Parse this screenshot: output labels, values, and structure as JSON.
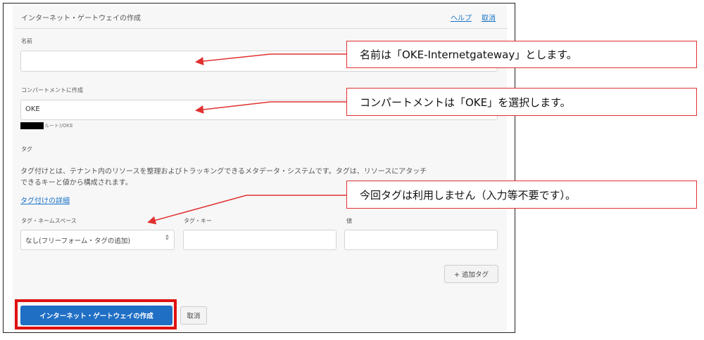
{
  "header": {
    "title": "インターネット・ゲートウェイの作成",
    "help_link": "ヘルプ",
    "cancel_link": "取消"
  },
  "name_field": {
    "label": "名前",
    "value": ""
  },
  "compartment_field": {
    "label": "コンパートメントに作成",
    "value": "OKE",
    "path": "ルート)/OKE"
  },
  "tags": {
    "heading": "タグ",
    "description_line1": "タグ付けとは、テナント内のリソースを整理およびトラッキングできるメタデータ・システムです。タグは、リソースにアタッチ",
    "description_line2": "できるキーと値から構成されます。",
    "learn_more_link": "タグ付けの詳細",
    "namespace_label": "タグ・ネームスペース",
    "namespace_value": "なし(フリーフォーム・タグの追加)",
    "key_label": "タグ・キー",
    "key_value": "",
    "value_label": "値",
    "value_value": "",
    "add_tag_button": "+ 追加タグ"
  },
  "footer": {
    "create_button": "インターネット・ゲートウェイの作成",
    "cancel_button": "取消"
  },
  "annotations": [
    {
      "text": "名前は「OKE-Internetgateway」とします。"
    },
    {
      "text": "コンパートメントは「OKE」を選択します。"
    },
    {
      "text": "今回タグは利用しません（入力等不要です）。"
    }
  ],
  "colors": {
    "primary": "#1f6fc5",
    "highlight": "#e01010",
    "link": "#1a73c8"
  }
}
